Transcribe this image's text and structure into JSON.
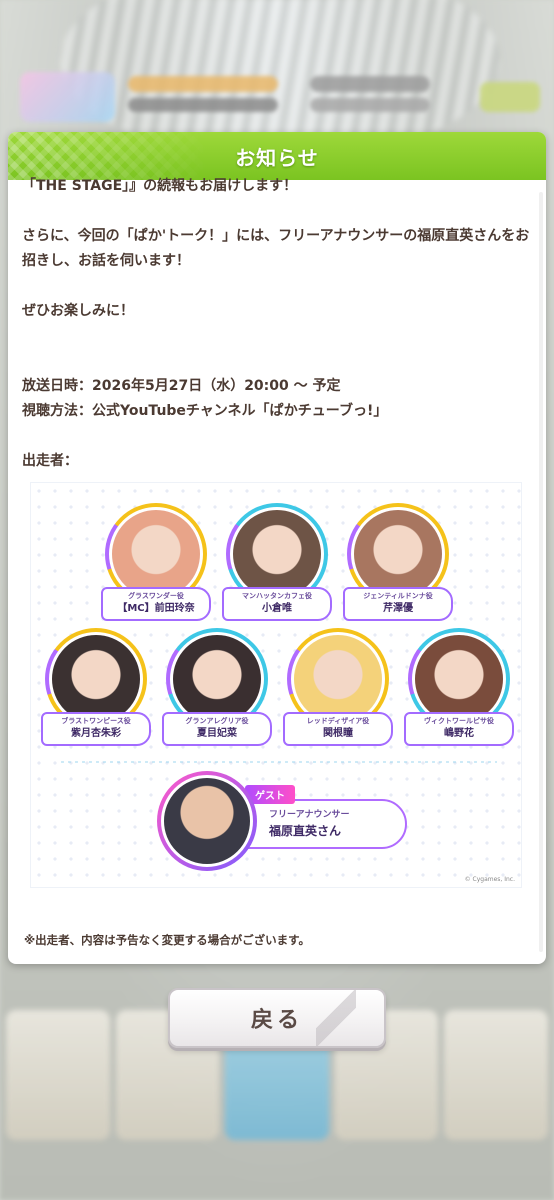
{
  "dialog": {
    "title": "お知らせ",
    "lines": [
      "「THE STAGE」』の続報もお届けします！",
      "さらに、今回の「ぱか'トーク！」には、フリーアナウンサーの福原直英さんをお招きし、お話を伺います！",
      "ぜひお楽しみに！",
      "放送日時：2026年5月27日（水）20:00 ～ 予定",
      "視聴方法：公式YouTubeチャンネル「ぱかチューブっ!」",
      "出走者："
    ],
    "note": "※出走者、内容は予告なく変更する場合がございます。"
  },
  "cast": {
    "members": [
      {
        "role": "グラスワンダー役",
        "name": "【MC】前田玲奈",
        "color": "#f5c21a",
        "face": "#e8a489"
      },
      {
        "role": "マンハッタンカフェ役",
        "name": "小倉唯",
        "color": "#3ec8e6",
        "face": "#6e5446"
      },
      {
        "role": "ジェンティルドンナ役",
        "name": "芹澤優",
        "color": "#f5c21a",
        "face": "#a87660"
      },
      {
        "role": "ブラストワンピース役",
        "name": "紫月杏朱彩",
        "color": "#f5c21a",
        "face": "#3b3131"
      },
      {
        "role": "グランアレグリア役",
        "name": "夏目妃菜",
        "color": "#3ec8e6",
        "face": "#3a2f30"
      },
      {
        "role": "レッドディザイア役",
        "name": "関根瞳",
        "color": "#f5c21a",
        "face": "#f4d27a"
      },
      {
        "role": "ヴィクトワールピサ役",
        "name": "嶋野花",
        "color": "#3ec8e6",
        "face": "#7a4c3c"
      }
    ],
    "guest": {
      "tag": "ゲスト",
      "role": "フリーアナウンサー",
      "name": "福原直英さん"
    },
    "copyright": "© Cygames, Inc."
  },
  "back_button": {
    "label": "戻る"
  }
}
